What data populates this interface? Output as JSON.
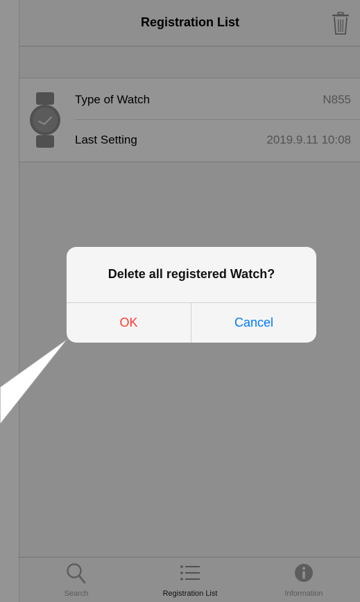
{
  "nav": {
    "title": "Registration List",
    "trash_icon": "trash-icon"
  },
  "watch_entry": {
    "icon": "watch-icon",
    "rows": [
      {
        "label": "Type of Watch",
        "value": "N855"
      },
      {
        "label": "Last Setting",
        "value": "2019.9.11 10:08"
      }
    ]
  },
  "tabbar": {
    "items": [
      {
        "label": "Search",
        "icon": "magnifier-icon",
        "active": false
      },
      {
        "label": "Registration List",
        "icon": "list-icon",
        "active": true
      },
      {
        "label": "Information",
        "icon": "info-icon",
        "active": false
      }
    ]
  },
  "alert": {
    "title": "Delete all registered Watch?",
    "ok_label": "OK",
    "cancel_label": "Cancel"
  },
  "colors": {
    "destructive": "#ff3b30",
    "action": "#007aff",
    "overlay": "rgba(0,0,0,0.42)"
  }
}
